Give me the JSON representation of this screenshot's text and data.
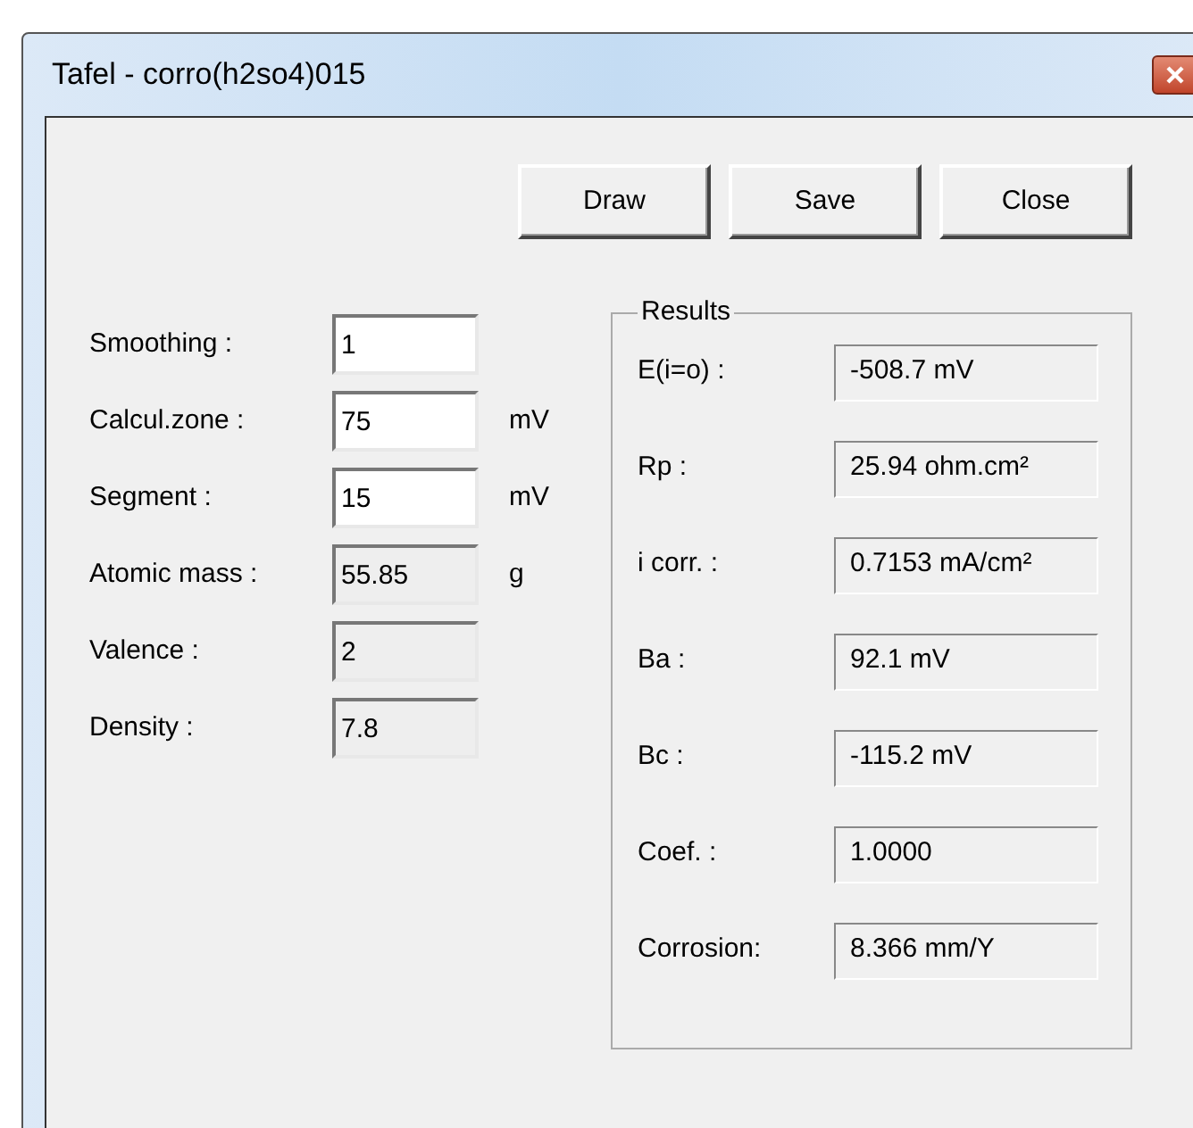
{
  "window": {
    "title": "Tafel - corro(h2so4)015"
  },
  "buttons": [
    "Draw",
    "Save",
    "Close"
  ],
  "parameters": [
    {
      "label": "Smoothing :",
      "value": "1",
      "editable": true
    },
    {
      "label": "Calcul.zone :",
      "value": "75",
      "unit": "mV",
      "editable": true
    },
    {
      "label": "Segment :",
      "value": "15",
      "unit": "mV",
      "editable": true
    },
    {
      "label": "Atomic mass :",
      "value": "55.85",
      "unit": "g",
      "editable": false
    },
    {
      "label": "Valence :",
      "value": "2",
      "editable": false
    },
    {
      "label": "Density :",
      "value": "7.8",
      "editable": false
    }
  ],
  "results": {
    "title": "Results",
    "rows": [
      {
        "label": "E(i=o) :",
        "value": "-508.7 mV"
      },
      {
        "label": "Rp :",
        "value": "25.94 ohm.cm²"
      },
      {
        "label": "i corr. :",
        "value": "0.7153 mA/cm²"
      },
      {
        "label": "Ba :",
        "value": "92.1 mV"
      },
      {
        "label": "Bc :",
        "value": "-115.2 mV"
      },
      {
        "label": "Coef. :",
        "value": "1.0000"
      },
      {
        "label": "Corrosion:",
        "value": "8.366 mm/Y"
      }
    ]
  }
}
